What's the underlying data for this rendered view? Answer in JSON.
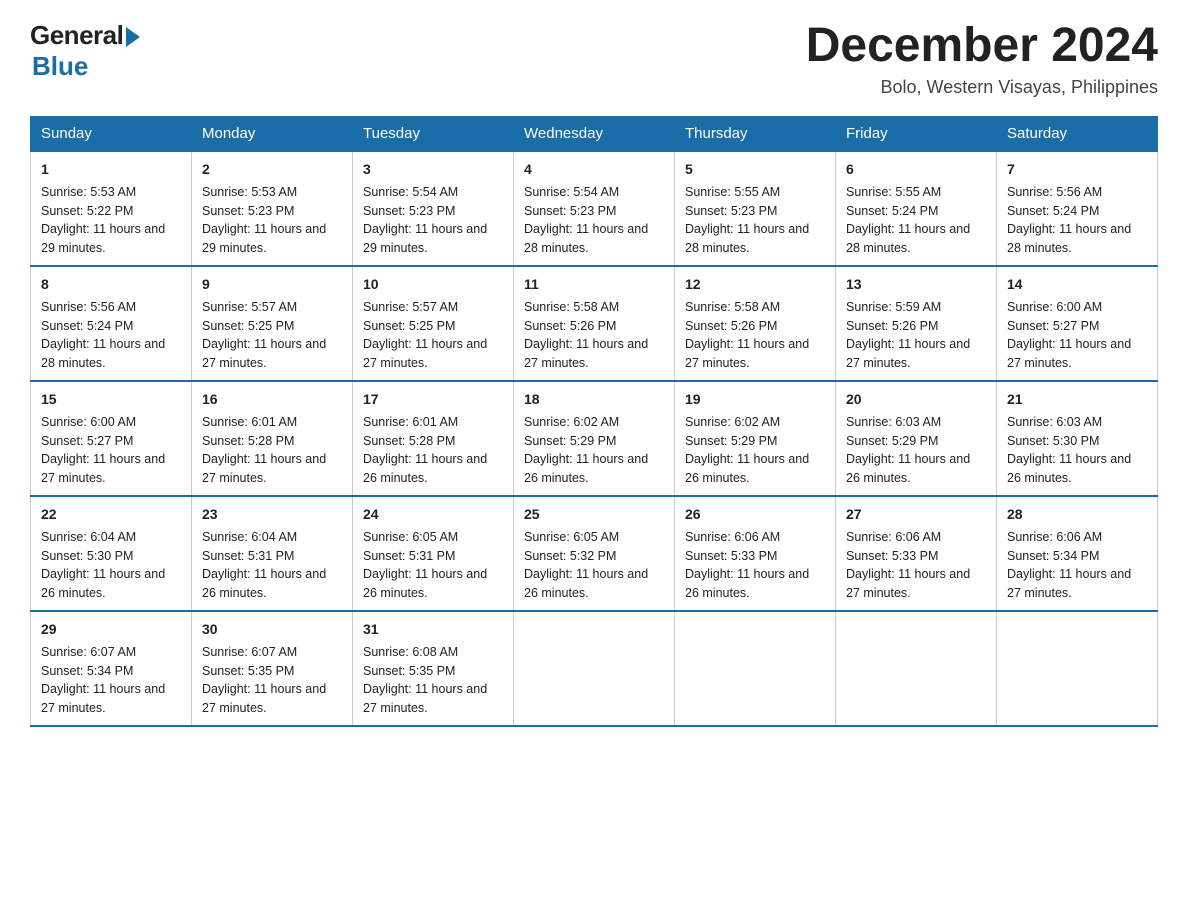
{
  "logo": {
    "general": "General",
    "blue": "Blue"
  },
  "title": "December 2024",
  "location": "Bolo, Western Visayas, Philippines",
  "days_of_week": [
    "Sunday",
    "Monday",
    "Tuesday",
    "Wednesday",
    "Thursday",
    "Friday",
    "Saturday"
  ],
  "weeks": [
    [
      {
        "day": "1",
        "sunrise": "5:53 AM",
        "sunset": "5:22 PM",
        "daylight": "11 hours and 29 minutes."
      },
      {
        "day": "2",
        "sunrise": "5:53 AM",
        "sunset": "5:23 PM",
        "daylight": "11 hours and 29 minutes."
      },
      {
        "day": "3",
        "sunrise": "5:54 AM",
        "sunset": "5:23 PM",
        "daylight": "11 hours and 29 minutes."
      },
      {
        "day": "4",
        "sunrise": "5:54 AM",
        "sunset": "5:23 PM",
        "daylight": "11 hours and 28 minutes."
      },
      {
        "day": "5",
        "sunrise": "5:55 AM",
        "sunset": "5:23 PM",
        "daylight": "11 hours and 28 minutes."
      },
      {
        "day": "6",
        "sunrise": "5:55 AM",
        "sunset": "5:24 PM",
        "daylight": "11 hours and 28 minutes."
      },
      {
        "day": "7",
        "sunrise": "5:56 AM",
        "sunset": "5:24 PM",
        "daylight": "11 hours and 28 minutes."
      }
    ],
    [
      {
        "day": "8",
        "sunrise": "5:56 AM",
        "sunset": "5:24 PM",
        "daylight": "11 hours and 28 minutes."
      },
      {
        "day": "9",
        "sunrise": "5:57 AM",
        "sunset": "5:25 PM",
        "daylight": "11 hours and 27 minutes."
      },
      {
        "day": "10",
        "sunrise": "5:57 AM",
        "sunset": "5:25 PM",
        "daylight": "11 hours and 27 minutes."
      },
      {
        "day": "11",
        "sunrise": "5:58 AM",
        "sunset": "5:26 PM",
        "daylight": "11 hours and 27 minutes."
      },
      {
        "day": "12",
        "sunrise": "5:58 AM",
        "sunset": "5:26 PM",
        "daylight": "11 hours and 27 minutes."
      },
      {
        "day": "13",
        "sunrise": "5:59 AM",
        "sunset": "5:26 PM",
        "daylight": "11 hours and 27 minutes."
      },
      {
        "day": "14",
        "sunrise": "6:00 AM",
        "sunset": "5:27 PM",
        "daylight": "11 hours and 27 minutes."
      }
    ],
    [
      {
        "day": "15",
        "sunrise": "6:00 AM",
        "sunset": "5:27 PM",
        "daylight": "11 hours and 27 minutes."
      },
      {
        "day": "16",
        "sunrise": "6:01 AM",
        "sunset": "5:28 PM",
        "daylight": "11 hours and 27 minutes."
      },
      {
        "day": "17",
        "sunrise": "6:01 AM",
        "sunset": "5:28 PM",
        "daylight": "11 hours and 26 minutes."
      },
      {
        "day": "18",
        "sunrise": "6:02 AM",
        "sunset": "5:29 PM",
        "daylight": "11 hours and 26 minutes."
      },
      {
        "day": "19",
        "sunrise": "6:02 AM",
        "sunset": "5:29 PM",
        "daylight": "11 hours and 26 minutes."
      },
      {
        "day": "20",
        "sunrise": "6:03 AM",
        "sunset": "5:29 PM",
        "daylight": "11 hours and 26 minutes."
      },
      {
        "day": "21",
        "sunrise": "6:03 AM",
        "sunset": "5:30 PM",
        "daylight": "11 hours and 26 minutes."
      }
    ],
    [
      {
        "day": "22",
        "sunrise": "6:04 AM",
        "sunset": "5:30 PM",
        "daylight": "11 hours and 26 minutes."
      },
      {
        "day": "23",
        "sunrise": "6:04 AM",
        "sunset": "5:31 PM",
        "daylight": "11 hours and 26 minutes."
      },
      {
        "day": "24",
        "sunrise": "6:05 AM",
        "sunset": "5:31 PM",
        "daylight": "11 hours and 26 minutes."
      },
      {
        "day": "25",
        "sunrise": "6:05 AM",
        "sunset": "5:32 PM",
        "daylight": "11 hours and 26 minutes."
      },
      {
        "day": "26",
        "sunrise": "6:06 AM",
        "sunset": "5:33 PM",
        "daylight": "11 hours and 26 minutes."
      },
      {
        "day": "27",
        "sunrise": "6:06 AM",
        "sunset": "5:33 PM",
        "daylight": "11 hours and 27 minutes."
      },
      {
        "day": "28",
        "sunrise": "6:06 AM",
        "sunset": "5:34 PM",
        "daylight": "11 hours and 27 minutes."
      }
    ],
    [
      {
        "day": "29",
        "sunrise": "6:07 AM",
        "sunset": "5:34 PM",
        "daylight": "11 hours and 27 minutes."
      },
      {
        "day": "30",
        "sunrise": "6:07 AM",
        "sunset": "5:35 PM",
        "daylight": "11 hours and 27 minutes."
      },
      {
        "day": "31",
        "sunrise": "6:08 AM",
        "sunset": "5:35 PM",
        "daylight": "11 hours and 27 minutes."
      },
      null,
      null,
      null,
      null
    ]
  ]
}
